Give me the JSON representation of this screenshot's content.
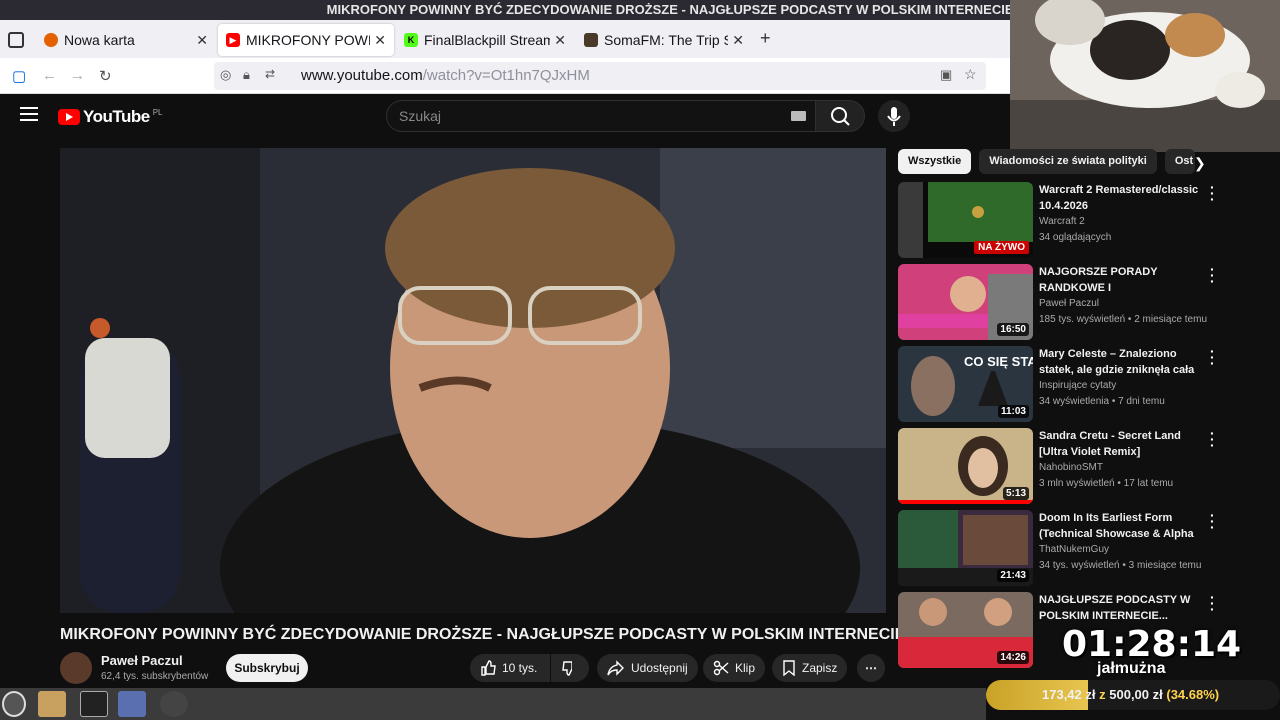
{
  "window": {
    "title": "MIKROFONY POWINNY BYĆ ZDECYDOWANIE DROŻSZE - NAJGŁUPSZE PODCASTY W POLSKIM INTERNECIE! - YouTube — Mozilla Firefox"
  },
  "tabs": [
    {
      "label": "Nowa karta",
      "icon": "firefox-icon",
      "active": false
    },
    {
      "label": "MIKROFONY POWINNY",
      "icon": "youtube-icon",
      "active": true
    },
    {
      "label": "FinalBlackpill Stream",
      "icon": "kick-icon",
      "active": false
    },
    {
      "label": "SomaFM: The Trip Sc",
      "icon": "somafm-icon",
      "active": false
    }
  ],
  "address_bar": {
    "host": "www.youtube.com",
    "path": "/watch?v=Ot1hn7QJxHM"
  },
  "youtube": {
    "logo_text": "YouTube",
    "country": "PL",
    "search_placeholder": "Szukaj"
  },
  "video": {
    "title": "MIKROFONY POWINNY BYĆ ZDECYDOWANIE DROŻSZE - NAJGŁUPSZE PODCASTY W POLSKIM INTERNECIE!",
    "channel": "Paweł Paczul",
    "subscribers": "62,4 tys. subskrybentów",
    "subscribe_label": "Subskrybuj",
    "likes": "10 tys.",
    "share_label": "Udostępnij",
    "clip_label": "Klip",
    "save_label": "Zapisz"
  },
  "chips": [
    "Wszystkie",
    "Wiadomości ze świata polityki",
    "Ost"
  ],
  "recommendations": [
    {
      "title": "Warcraft 2 Remastered/classic 10.4.2026",
      "channel": "Warcraft 2",
      "meta": "34 oglądających",
      "badge": "NA ŻYWO",
      "live": true
    },
    {
      "title": "NAJGORSZE PORADY RANDKOWE I NAJDZIWNIEJS...",
      "channel": "Paweł Paczul",
      "meta": "185 tys. wyświetleń • 2 miesiące temu",
      "badge": "16:50",
      "live": false
    },
    {
      "title": "Mary Celeste – Znaleziono statek, ale gdzie zniknęła cała ...",
      "channel": "Inspirujące cytaty",
      "meta": "34 wyświetlenia • 7 dni temu",
      "badge": "11:03",
      "live": false
    },
    {
      "title": "Sandra Cretu - Secret Land [Ultra Violet Remix]",
      "channel": "NahobinoSMT",
      "meta": "3 mln wyświetleń • 17 lat temu",
      "badge": "5:13",
      "live": false
    },
    {
      "title": "Doom In Its Earliest Form (Technical Showcase & Alpha ...",
      "channel": "ThatNukemGuy",
      "meta": "34 tys. wyświetleń • 3 miesiące temu",
      "badge": "21:43",
      "live": false
    },
    {
      "title": "NAJGŁUPSZE PODCASTY W POLSKIM INTERNECIE...",
      "channel": "",
      "meta": "",
      "badge": "14:26",
      "live": false
    }
  ],
  "overlay": {
    "timer": "01:28:14",
    "timer_label": "jałmużna",
    "donation_current": "173,42 zł",
    "donation_sep": "z",
    "donation_goal": "500,00 zł",
    "donation_percent": "(34.68%)",
    "donation_fraction": 0.3468
  }
}
